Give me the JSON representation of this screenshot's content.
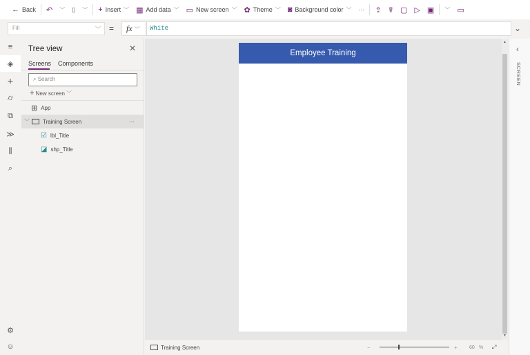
{
  "toolbar": {
    "back": "Back",
    "insert": "Insert",
    "add_data": "Add data",
    "new_screen": "New screen",
    "theme": "Theme",
    "background_color": "Background color",
    "more": "···"
  },
  "formula": {
    "property": "Fill",
    "equals": "=",
    "fx": "fx",
    "value": "White"
  },
  "tree": {
    "title": "Tree view",
    "tabs": [
      "Screens",
      "Components"
    ],
    "search_placeholder": "Search",
    "new_screen": "New screen",
    "items": [
      {
        "label": "App"
      },
      {
        "label": "Training Screen",
        "more": "···"
      },
      {
        "label": "lbl_Title"
      },
      {
        "label": "shp_Title"
      }
    ]
  },
  "canvas": {
    "header_title": "Employee Training",
    "header_color": "#365aad"
  },
  "right_panel": {
    "label": "SCREEN"
  },
  "status": {
    "screen_name": "Training Screen",
    "zoom_value": "60",
    "zoom_unit": "%",
    "zoom_percent": 60
  }
}
